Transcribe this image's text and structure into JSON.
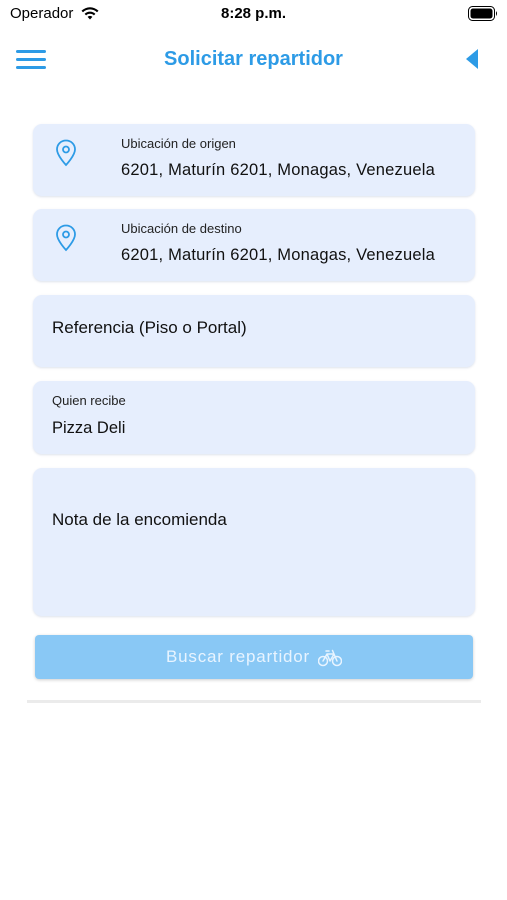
{
  "status_bar": {
    "carrier": "Operador",
    "time": "8:28 p.m."
  },
  "nav": {
    "title": "Solicitar repartidor",
    "menu_icon": "hamburger-menu-icon",
    "back_icon": "back-triangle-icon"
  },
  "form": {
    "origin": {
      "label": "Ubicación de origen",
      "value": "6201, Maturín 6201, Monagas, Venezuela",
      "icon": "location-pin-icon"
    },
    "destination": {
      "label": "Ubicación de destino",
      "value": "6201, Maturín 6201, Monagas, Venezuela",
      "icon": "location-pin-icon"
    },
    "reference": {
      "placeholder": "Referencia (Piso o Portal)"
    },
    "receiver": {
      "label": "Quien recibe",
      "value": "Pizza Deli"
    },
    "note": {
      "placeholder": "Nota de la encomienda"
    }
  },
  "actions": {
    "search_label": "Buscar repartidor",
    "search_icon": "bicycle-icon"
  },
  "colors": {
    "accent": "#2d9be6",
    "card_bg": "#e6eefd",
    "button_bg": "#89c8f5"
  }
}
